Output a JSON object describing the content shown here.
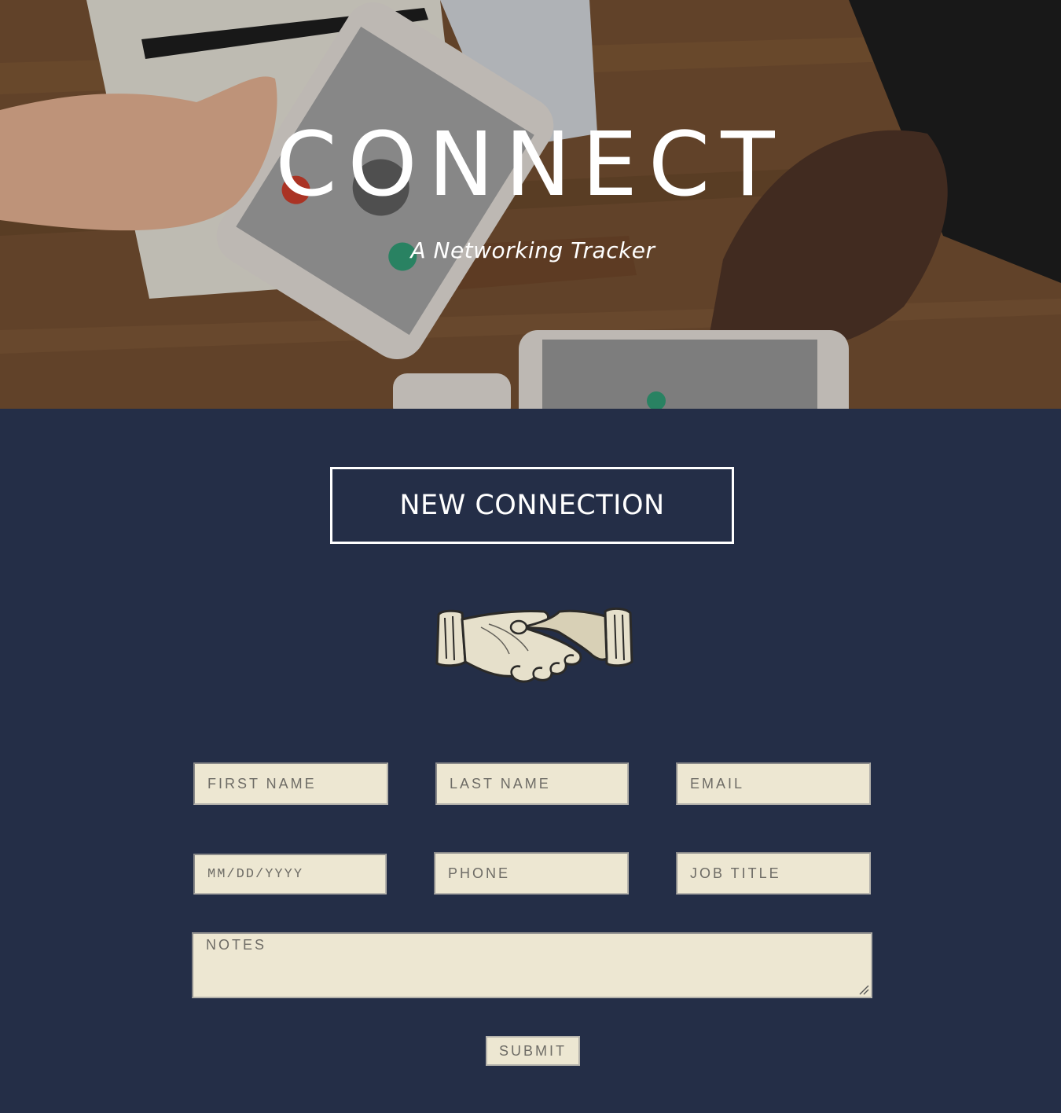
{
  "hero": {
    "title": "CONNECT",
    "subtitle": "A Networking Tracker"
  },
  "section": {
    "new_connection_label": "NEW CONNECTION"
  },
  "form": {
    "first_name": {
      "placeholder": "FIRST NAME"
    },
    "last_name": {
      "placeholder": "LAST NAME"
    },
    "email": {
      "placeholder": "EMAIL"
    },
    "date": {
      "placeholder": "MM/DD/YYYY"
    },
    "phone": {
      "placeholder": "PHONE"
    },
    "job_title": {
      "placeholder": "JOB TITLE"
    },
    "notes": {
      "placeholder": "NOTES"
    },
    "submit_label": "SUBMIT"
  },
  "icons": {
    "hero_image": "photo-hands-smartphones",
    "logo": "handshake-icon"
  },
  "colors": {
    "page_background": "#242e47",
    "field_background": "#ede7d2",
    "field_text": "#6e6c66",
    "heading_text": "#ffffff"
  }
}
